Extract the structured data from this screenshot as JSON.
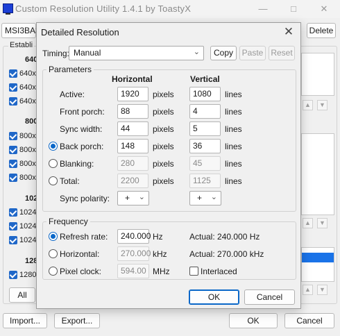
{
  "main": {
    "title": "Custom Resolution Utility 1.4.1 by ToastyX",
    "monitor": "MSI3BA3",
    "delete_label": "Delete",
    "established_label": "Establi",
    "groups": [
      {
        "header": "640",
        "items": [
          "640x",
          "640x",
          "640x"
        ]
      },
      {
        "header": "800",
        "items": [
          "800x",
          "800x",
          "800x",
          "800x"
        ]
      },
      {
        "header": "102",
        "items": [
          "1024",
          "1024",
          "1024"
        ]
      },
      {
        "header": "128",
        "items": [
          "1280"
        ]
      }
    ],
    "all_label": "All",
    "import_label": "Import...",
    "export_label": "Export...",
    "ok_label": "OK",
    "cancel_label": "Cancel"
  },
  "dialog": {
    "title": "Detailed Resolution",
    "timing_label": "Timing:",
    "timing_value": "Manual",
    "copy_label": "Copy",
    "paste_label": "Paste",
    "reset_label": "Reset",
    "parameters_title": "Parameters",
    "col_horizontal": "Horizontal",
    "col_vertical": "Vertical",
    "rows": {
      "active": {
        "label": "Active:",
        "h": "1920",
        "h_unit": "pixels",
        "v": "1080",
        "v_unit": "lines"
      },
      "front_porch": {
        "label": "Front porch:",
        "h": "88",
        "h_unit": "pixels",
        "v": "4",
        "v_unit": "lines"
      },
      "sync_width": {
        "label": "Sync width:",
        "h": "44",
        "h_unit": "pixels",
        "v": "5",
        "v_unit": "lines"
      },
      "back_porch": {
        "label": "Back porch:",
        "h": "148",
        "h_unit": "pixels",
        "v": "36",
        "v_unit": "lines"
      },
      "blanking": {
        "label": "Blanking:",
        "h": "280",
        "h_unit": "pixels",
        "v": "45",
        "v_unit": "lines"
      },
      "total": {
        "label": "Total:",
        "h": "2200",
        "h_unit": "pixels",
        "v": "1125",
        "v_unit": "lines"
      }
    },
    "sync_polarity_label": "Sync polarity:",
    "sync_polarity_h": "+",
    "sync_polarity_v": "+",
    "frequency_title": "Frequency",
    "refresh_label": "Refresh rate:",
    "refresh_value": "240.000",
    "refresh_unit": "Hz",
    "refresh_actual": "Actual: 240.000 Hz",
    "horizontal_label": "Horizontal:",
    "horizontal_value": "270.000",
    "horizontal_unit": "kHz",
    "horizontal_actual": "Actual: 270.000 kHz",
    "pixel_clock_label": "Pixel clock:",
    "pixel_clock_value": "594.00",
    "pixel_clock_unit": "MHz",
    "interlaced_label": "Interlaced",
    "ok_label": "OK",
    "cancel_label": "Cancel"
  },
  "colors": {
    "accent": "#0a67c8",
    "checkbox_blue": "#1f67c8",
    "selection_blue": "#1a73e8"
  }
}
